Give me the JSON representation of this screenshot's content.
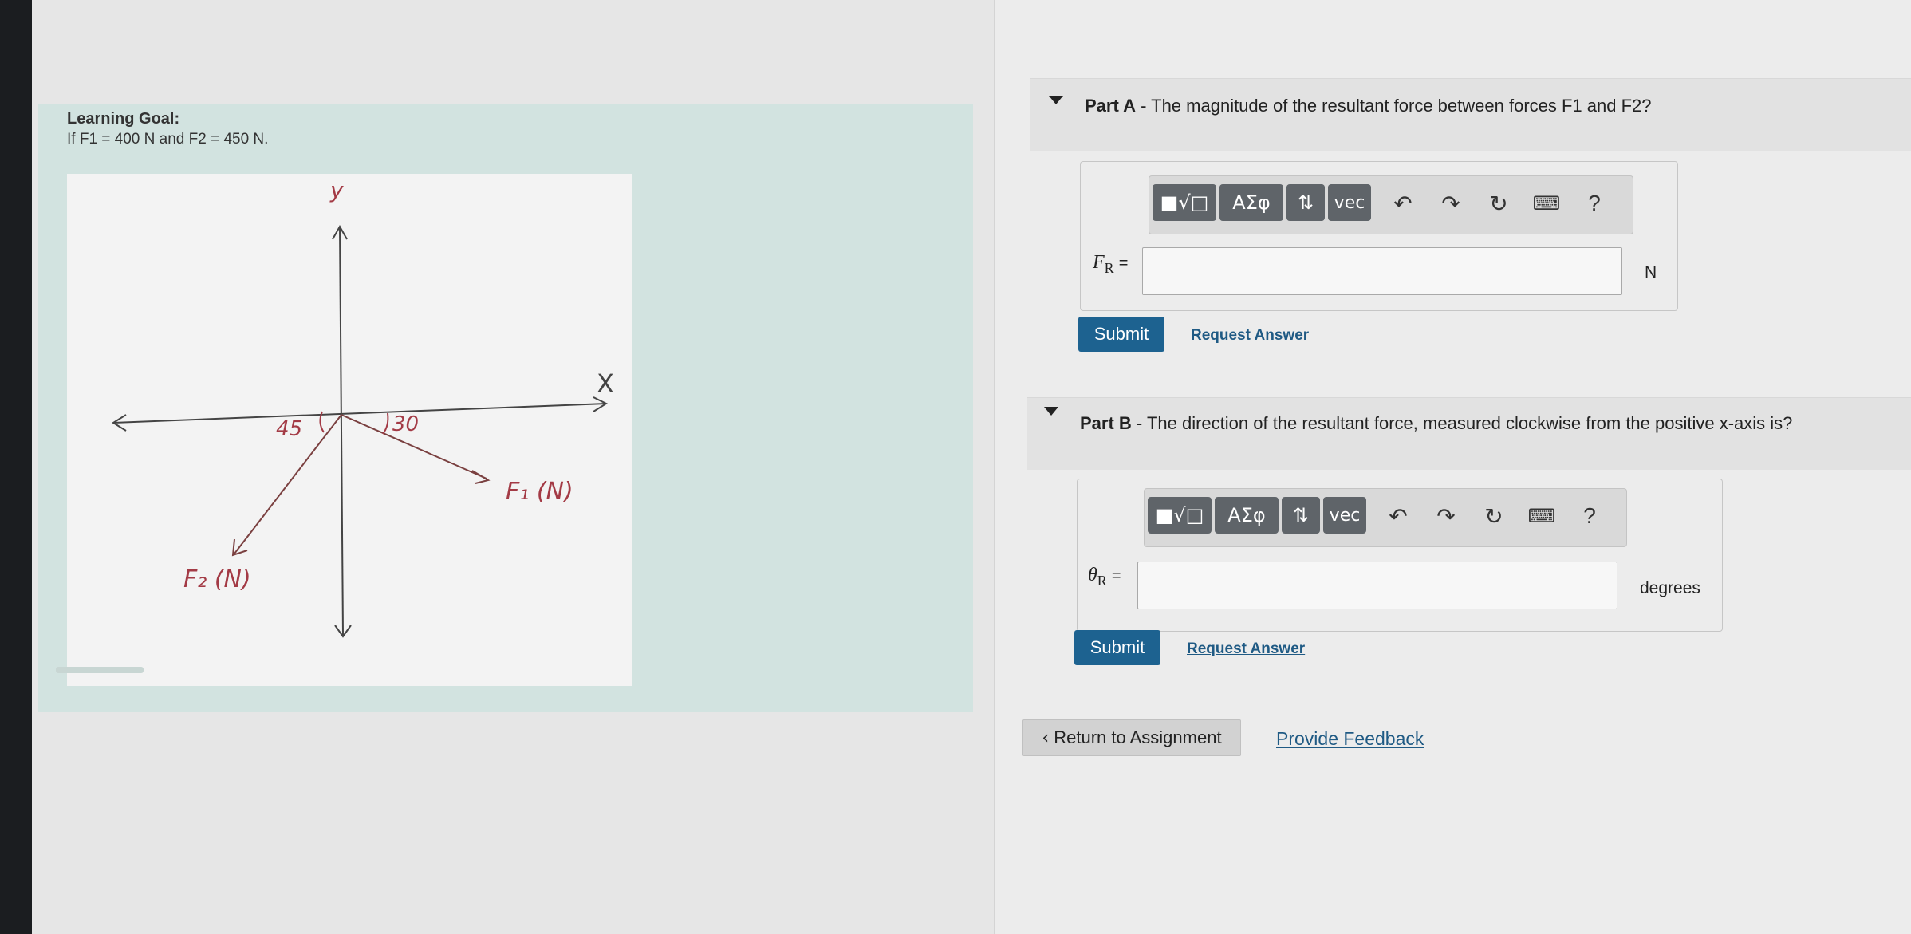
{
  "learning_goal": {
    "title": "Learning Goal:",
    "text": "If F1 = 400 N and F2 = 450 N.",
    "figure": {
      "y_axis_label": "y",
      "x_axis_label": "X",
      "angle_f1": "30",
      "angle_f2": "45",
      "f1_label": "F₁ (N)",
      "f2_label": "F₂ (N)",
      "ink_color": "#a33a45"
    }
  },
  "toolbar": {
    "templates_label": "■√□",
    "greek_label": "ΑΣφ",
    "arrows_label": "⇅",
    "vec_label": "vec",
    "undo_icon": "undo-icon",
    "redo_icon": "redo-icon",
    "reset_icon": "reset-icon",
    "keyboard_icon": "keyboard-icon",
    "help_label": "?"
  },
  "part_a": {
    "label": "Part A",
    "question": " - The magnitude of the resultant force between forces F1 and F2?",
    "variable": "F",
    "variable_sub": "R",
    "equals": "=",
    "input_value": "",
    "unit": "N",
    "submit_label": "Submit",
    "request_label": "Request Answer"
  },
  "part_b": {
    "label": "Part B",
    "question": " - The direction of the resultant force, measured clockwise from the positive x-axis is?",
    "variable": "θ",
    "variable_sub": "R",
    "equals": "=",
    "input_value": "",
    "unit": "degrees",
    "submit_label": "Submit",
    "request_label": "Request Answer"
  },
  "footer": {
    "return_label": "Return to Assignment",
    "feedback_label": "Provide Feedback"
  },
  "colors": {
    "submit": "#1d6290",
    "link": "#1f5a84",
    "goal_panel": "#d2e3e0"
  }
}
